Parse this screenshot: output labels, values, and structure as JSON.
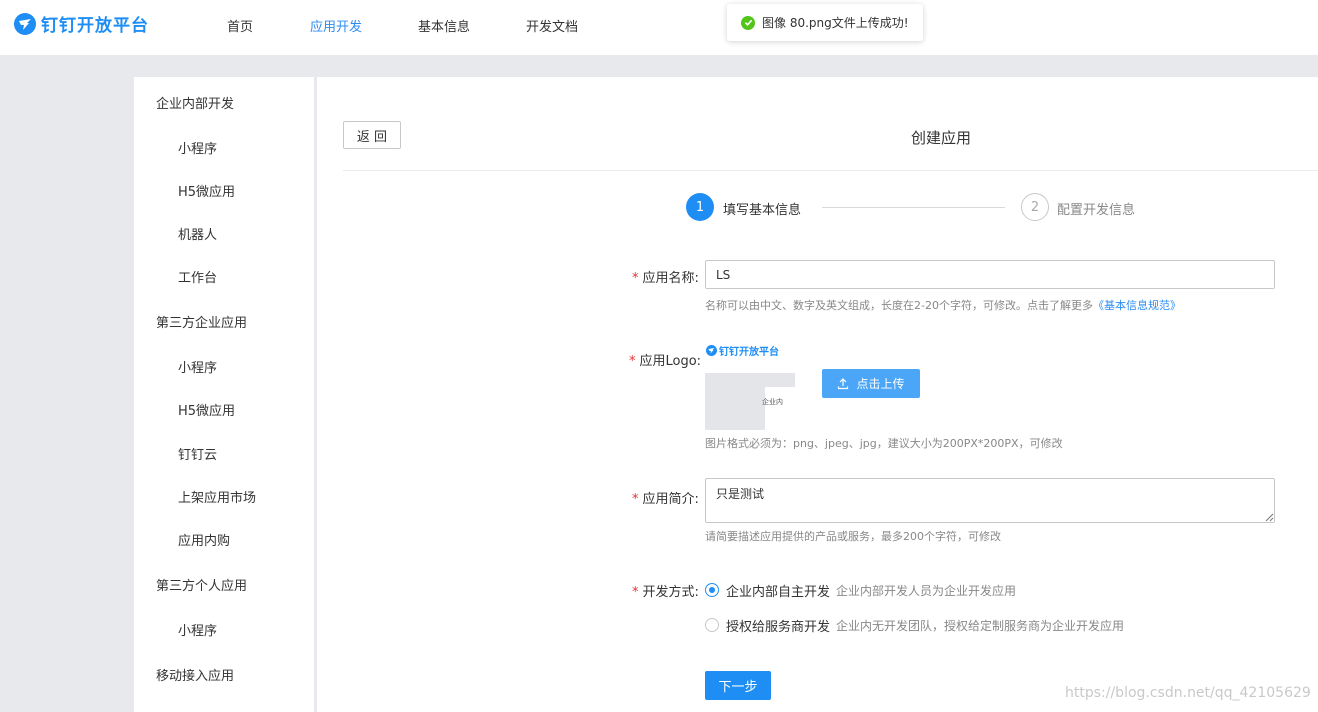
{
  "topbar": {
    "logo_text": "钉钉开放平台",
    "nav": [
      {
        "label": "首页",
        "active": false
      },
      {
        "label": "应用开发",
        "active": true
      },
      {
        "label": "基本信息",
        "active": false
      },
      {
        "label": "开发文档",
        "active": false
      }
    ]
  },
  "toast": {
    "text": "图像 80.png文件上传成功!",
    "status": "success"
  },
  "sidebar": {
    "groups": [
      {
        "label": "企业内部开发",
        "items": [
          "小程序",
          "H5微应用",
          "机器人",
          "工作台"
        ]
      },
      {
        "label": "第三方企业应用",
        "items": [
          "小程序",
          "H5微应用",
          "钉钉云",
          "上架应用市场",
          "应用内购"
        ]
      },
      {
        "label": "第三方个人应用",
        "items": [
          "小程序"
        ]
      },
      {
        "label": "移动接入应用",
        "items": []
      }
    ]
  },
  "main": {
    "back_label": "返 回",
    "title": "创建应用",
    "steps": [
      {
        "num": "1",
        "label": "填写基本信息",
        "active": true
      },
      {
        "num": "2",
        "label": "配置开发信息",
        "active": false
      }
    ],
    "form": {
      "required_mark": "*",
      "name": {
        "label": "应用名称:",
        "value": "LS",
        "hint": "名称可以由中文、数字及英文组成，长度在2-20个字符，可修改。点击了解更多",
        "hint_link": "《基本信息规范》"
      },
      "logo": {
        "label": "应用Logo:",
        "logo_text": "钉钉开放平台",
        "preview_text": "企业内",
        "upload_label": "点击上传",
        "hint": "图片格式必须为：png、jpeg、jpg，建议大小为200PX*200PX，可修改"
      },
      "intro": {
        "label": "应用简介:",
        "value": "只是测试",
        "hint": "请简要描述应用提供的产品或服务，最多200个字符，可修改"
      },
      "dev_mode": {
        "label": "开发方式:",
        "options": [
          {
            "label": "企业内部自主开发",
            "desc": "企业内部开发人员为企业开发应用",
            "checked": true
          },
          {
            "label": "授权给服务商开发",
            "desc": "企业内无开发团队，授权给定制服务商为企业开发应用",
            "checked": false
          }
        ]
      },
      "next_label": "下一步"
    }
  },
  "watermark": "https://blog.csdn.net/qq_42105629",
  "colors": {
    "accent": "#1e8ef5",
    "required": "#e5302f",
    "success": "#52c41a",
    "page_bg": "#e8e9ed"
  },
  "icons": [
    "dingtalk-logo-icon",
    "check-circle-icon",
    "upload-icon",
    "resize-grip-icon"
  ]
}
